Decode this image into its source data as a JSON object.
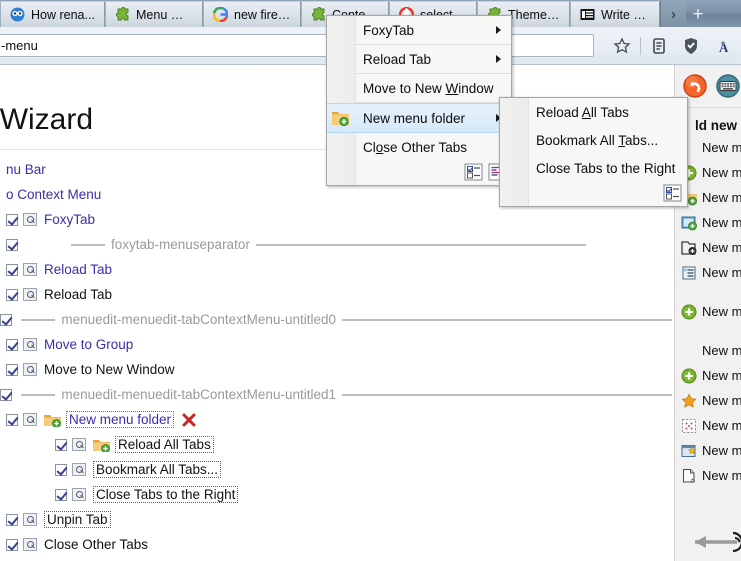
{
  "browser": {
    "tabs": [
      {
        "label": "How rena...",
        "icon": "owl-icon"
      },
      {
        "label": "Menu Wi...",
        "icon": "puzzle-icon"
      },
      {
        "label": "new firef...",
        "icon": "google-icon"
      },
      {
        "label": "Context ...",
        "icon": "puzzle-icon"
      },
      {
        "label": "selected t...",
        "icon": "opera-icon"
      },
      {
        "label": "Theme F...",
        "icon": "puzzle-icon"
      },
      {
        "label": "Write an ...",
        "icon": "article-icon"
      }
    ],
    "tab_scroll_label": "›",
    "new_tab_label": "+",
    "url_value": "-menu",
    "nav_icons": [
      "star-icon",
      "reader-icon",
      "shield-icon",
      "addon-icon"
    ]
  },
  "page": {
    "title": "nu Wizard",
    "tree": [
      {
        "indent": 0,
        "label": "nu Bar",
        "color": "purple",
        "checkbox": false,
        "magic": false,
        "kind": "plain"
      },
      {
        "indent": 0,
        "label": "o Context Menu",
        "color": "purple",
        "checkbox": false,
        "magic": false,
        "kind": "plain"
      },
      {
        "indent": 0,
        "label": "FoxyTab",
        "color": "purple",
        "checkbox": true,
        "magic": true,
        "kind": "item"
      },
      {
        "indent": 1,
        "label": "foxytab-menuseparator",
        "color": "gray",
        "checkbox": true,
        "magic": false,
        "kind": "separator"
      },
      {
        "indent": 0,
        "label": "Reload Tab",
        "color": "purple",
        "checkbox": true,
        "magic": true,
        "kind": "item"
      },
      {
        "indent": 0,
        "label": "Reload Tab",
        "color": "black",
        "checkbox": true,
        "magic": true,
        "kind": "item"
      },
      {
        "indent": 1,
        "label": "menuedit-menuedit-tabContextMenu-untitled0",
        "color": "gray",
        "checkbox": true,
        "magic": false,
        "kind": "separator"
      },
      {
        "indent": 0,
        "label": "Move to Group",
        "color": "purple",
        "checkbox": true,
        "magic": true,
        "kind": "item"
      },
      {
        "indent": 0,
        "label": "Move to New Window",
        "color": "black",
        "checkbox": true,
        "magic": true,
        "kind": "item"
      },
      {
        "indent": 1,
        "label": "menuedit-menuedit-tabContextMenu-untitled1",
        "color": "gray",
        "checkbox": true,
        "magic": false,
        "kind": "separator"
      },
      {
        "indent": 0,
        "label": "New menu folder",
        "color": "purple",
        "checkbox": true,
        "magic": true,
        "kind": "folder-edit"
      },
      {
        "indent": 2,
        "label": "Reload All Tabs",
        "color": "black",
        "checkbox": true,
        "magic": true,
        "kind": "folder-child"
      },
      {
        "indent": 2,
        "label": "Bookmark All Tabs...",
        "color": "black",
        "checkbox": true,
        "magic": true,
        "kind": "child"
      },
      {
        "indent": 2,
        "label": "Close Tabs to the Right",
        "color": "black",
        "checkbox": true,
        "magic": true,
        "kind": "child"
      },
      {
        "indent": 0,
        "label": "Unpin Tab",
        "color": "black",
        "checkbox": true,
        "magic": true,
        "kind": "child"
      },
      {
        "indent": 0,
        "label": "Close Other Tabs",
        "color": "black",
        "checkbox": true,
        "magic": true,
        "kind": "item"
      }
    ]
  },
  "right_panel": {
    "toolbar": [
      "undo-icon",
      "keyboard-icon"
    ],
    "heading": "ld new it",
    "rows": [
      {
        "label": "New me",
        "icon": "none"
      },
      {
        "label": "New me",
        "icon": "green-plus-icon"
      },
      {
        "label": "New me",
        "icon": "folder-add-icon"
      },
      {
        "label": "New me",
        "icon": "menu-add-icon"
      },
      {
        "label": "New me",
        "icon": "folder-outline-add-icon"
      },
      {
        "label": "New me",
        "icon": "list-add-icon"
      },
      {
        "label": "",
        "icon": "gap"
      },
      {
        "label": "New me",
        "icon": "green-plus-icon"
      },
      {
        "label": "",
        "icon": "gap"
      },
      {
        "label": "New me",
        "icon": "none"
      },
      {
        "label": "New me",
        "icon": "green-plus-icon"
      },
      {
        "label": "New me",
        "icon": "star-icon"
      },
      {
        "label": "New me",
        "icon": "dotted-box-icon"
      },
      {
        "label": "New me",
        "icon": "window-star-icon"
      },
      {
        "label": "New me",
        "icon": "page-icon"
      }
    ]
  },
  "context_menu": {
    "items": [
      {
        "label": "FoxyTab",
        "submenu": true,
        "selected": false,
        "icon": "none",
        "accel": ""
      },
      {
        "label": "Reload Tab",
        "submenu": true,
        "selected": false,
        "icon": "none",
        "accel": ""
      },
      {
        "label": "Move to New Window",
        "submenu": false,
        "selected": false,
        "icon": "none",
        "accel": "W"
      },
      {
        "label": "New menu folder",
        "submenu": true,
        "selected": true,
        "icon": "folder-add-icon",
        "accel": ""
      },
      {
        "label": "Close Other Tabs",
        "submenu": false,
        "selected": false,
        "icon": "none",
        "accel": "o"
      }
    ],
    "footer_icons": [
      "checklist-icon",
      "list-icon"
    ]
  },
  "submenu": {
    "items": [
      {
        "label": "Reload All Tabs",
        "accel": "A"
      },
      {
        "label": "Bookmark All Tabs...",
        "accel": "T"
      },
      {
        "label": "Close Tabs to the Right",
        "accel": "g"
      }
    ],
    "footer_icons": [
      "checklist-icon"
    ]
  },
  "colors": {
    "tabbar": "#7d92a8",
    "link": "#3b2ea8",
    "separator_text": "#9a9a9a",
    "edit_outline": "#c23b3b",
    "menu_bg": "#f7f7f5",
    "menu_selected": "#d5e9f9",
    "panel_bg": "#f1f1f1"
  }
}
